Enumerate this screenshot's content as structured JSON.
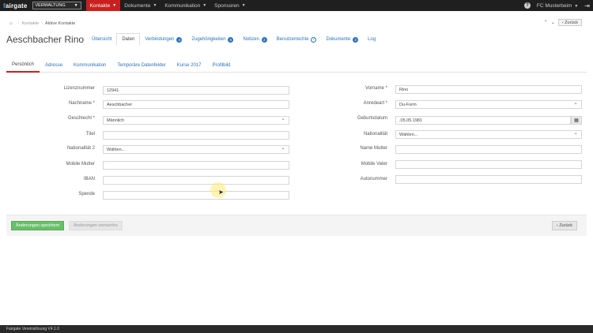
{
  "topbar": {
    "logo_prefix": "f",
    "logo_rest": "airgate",
    "mode": "VERWALTUNG",
    "nav": [
      {
        "label": "Kontakte",
        "active": true
      },
      {
        "label": "Dokumente",
        "active": false
      },
      {
        "label": "Kommunikation",
        "active": false
      },
      {
        "label": "Sponsoren",
        "active": false
      }
    ],
    "club": "FC Musterbeim",
    "help_symbol": "?"
  },
  "breadcrumb": {
    "items": [
      "Kontakte",
      "Aktive Kontakte"
    ],
    "back_label": "Zurück"
  },
  "header": {
    "title": "Aeschbacher Rino",
    "tabs": [
      {
        "label": "Übersicht",
        "active": false,
        "badge": null,
        "check": false
      },
      {
        "label": "Daten",
        "active": true,
        "badge": null,
        "check": false
      },
      {
        "label": "Verbindungen",
        "active": false,
        "badge": "4",
        "check": false
      },
      {
        "label": "Zugehörigkeiten",
        "active": false,
        "badge": "6",
        "check": false
      },
      {
        "label": "Notizen",
        "active": false,
        "badge": "2",
        "check": false
      },
      {
        "label": "Benutzerrechte",
        "active": false,
        "badge": null,
        "check": true
      },
      {
        "label": "Dokumente",
        "active": false,
        "badge": "2",
        "check": false
      },
      {
        "label": "Log",
        "active": false,
        "badge": null,
        "check": false
      }
    ]
  },
  "subtabs": [
    {
      "label": "Persönlich",
      "active": true
    },
    {
      "label": "Adresse",
      "active": false
    },
    {
      "label": "Kommunikation",
      "active": false
    },
    {
      "label": "Temporäre Datenfelder",
      "active": false
    },
    {
      "label": "Kurse 2017",
      "active": false
    },
    {
      "label": "Profilbild",
      "active": false
    }
  ],
  "form": {
    "left": [
      {
        "label": "Lizenznummer",
        "value": "12941",
        "type": "text"
      },
      {
        "label": "Nachname *",
        "value": "Aeschbacher",
        "type": "text"
      },
      {
        "label": "Geschlecht *",
        "value": "Männlich",
        "type": "select"
      },
      {
        "label": "Titel",
        "value": "",
        "type": "text"
      },
      {
        "label": "Nationalität 2",
        "value": "Wählen...",
        "type": "select"
      },
      {
        "label": "Mobile Mutter",
        "value": "",
        "type": "text"
      },
      {
        "label": "IBAN",
        "value": "",
        "type": "text"
      },
      {
        "label": "Spende",
        "value": "",
        "type": "text"
      }
    ],
    "right": [
      {
        "label": "Vorname *",
        "value": "Rino",
        "type": "text"
      },
      {
        "label": "Anredeart *",
        "value": "Du-Form",
        "type": "select"
      },
      {
        "label": "Geburtsdatum",
        "value": ".05.05.1981",
        "type": "date"
      },
      {
        "label": "Nationalität",
        "value": "Wählen...",
        "type": "select"
      },
      {
        "label": "Name Mutter",
        "value": "",
        "type": "text"
      },
      {
        "label": "Mobile Vater",
        "value": "",
        "type": "text"
      },
      {
        "label": "Autonummer",
        "value": "",
        "type": "text"
      }
    ]
  },
  "actions": {
    "save": "Änderungen speichern",
    "discard": "Änderungen verwerfen",
    "back": "Zurück"
  },
  "footer": {
    "version": "Fairgate Vereinslösung V4.1.0"
  }
}
